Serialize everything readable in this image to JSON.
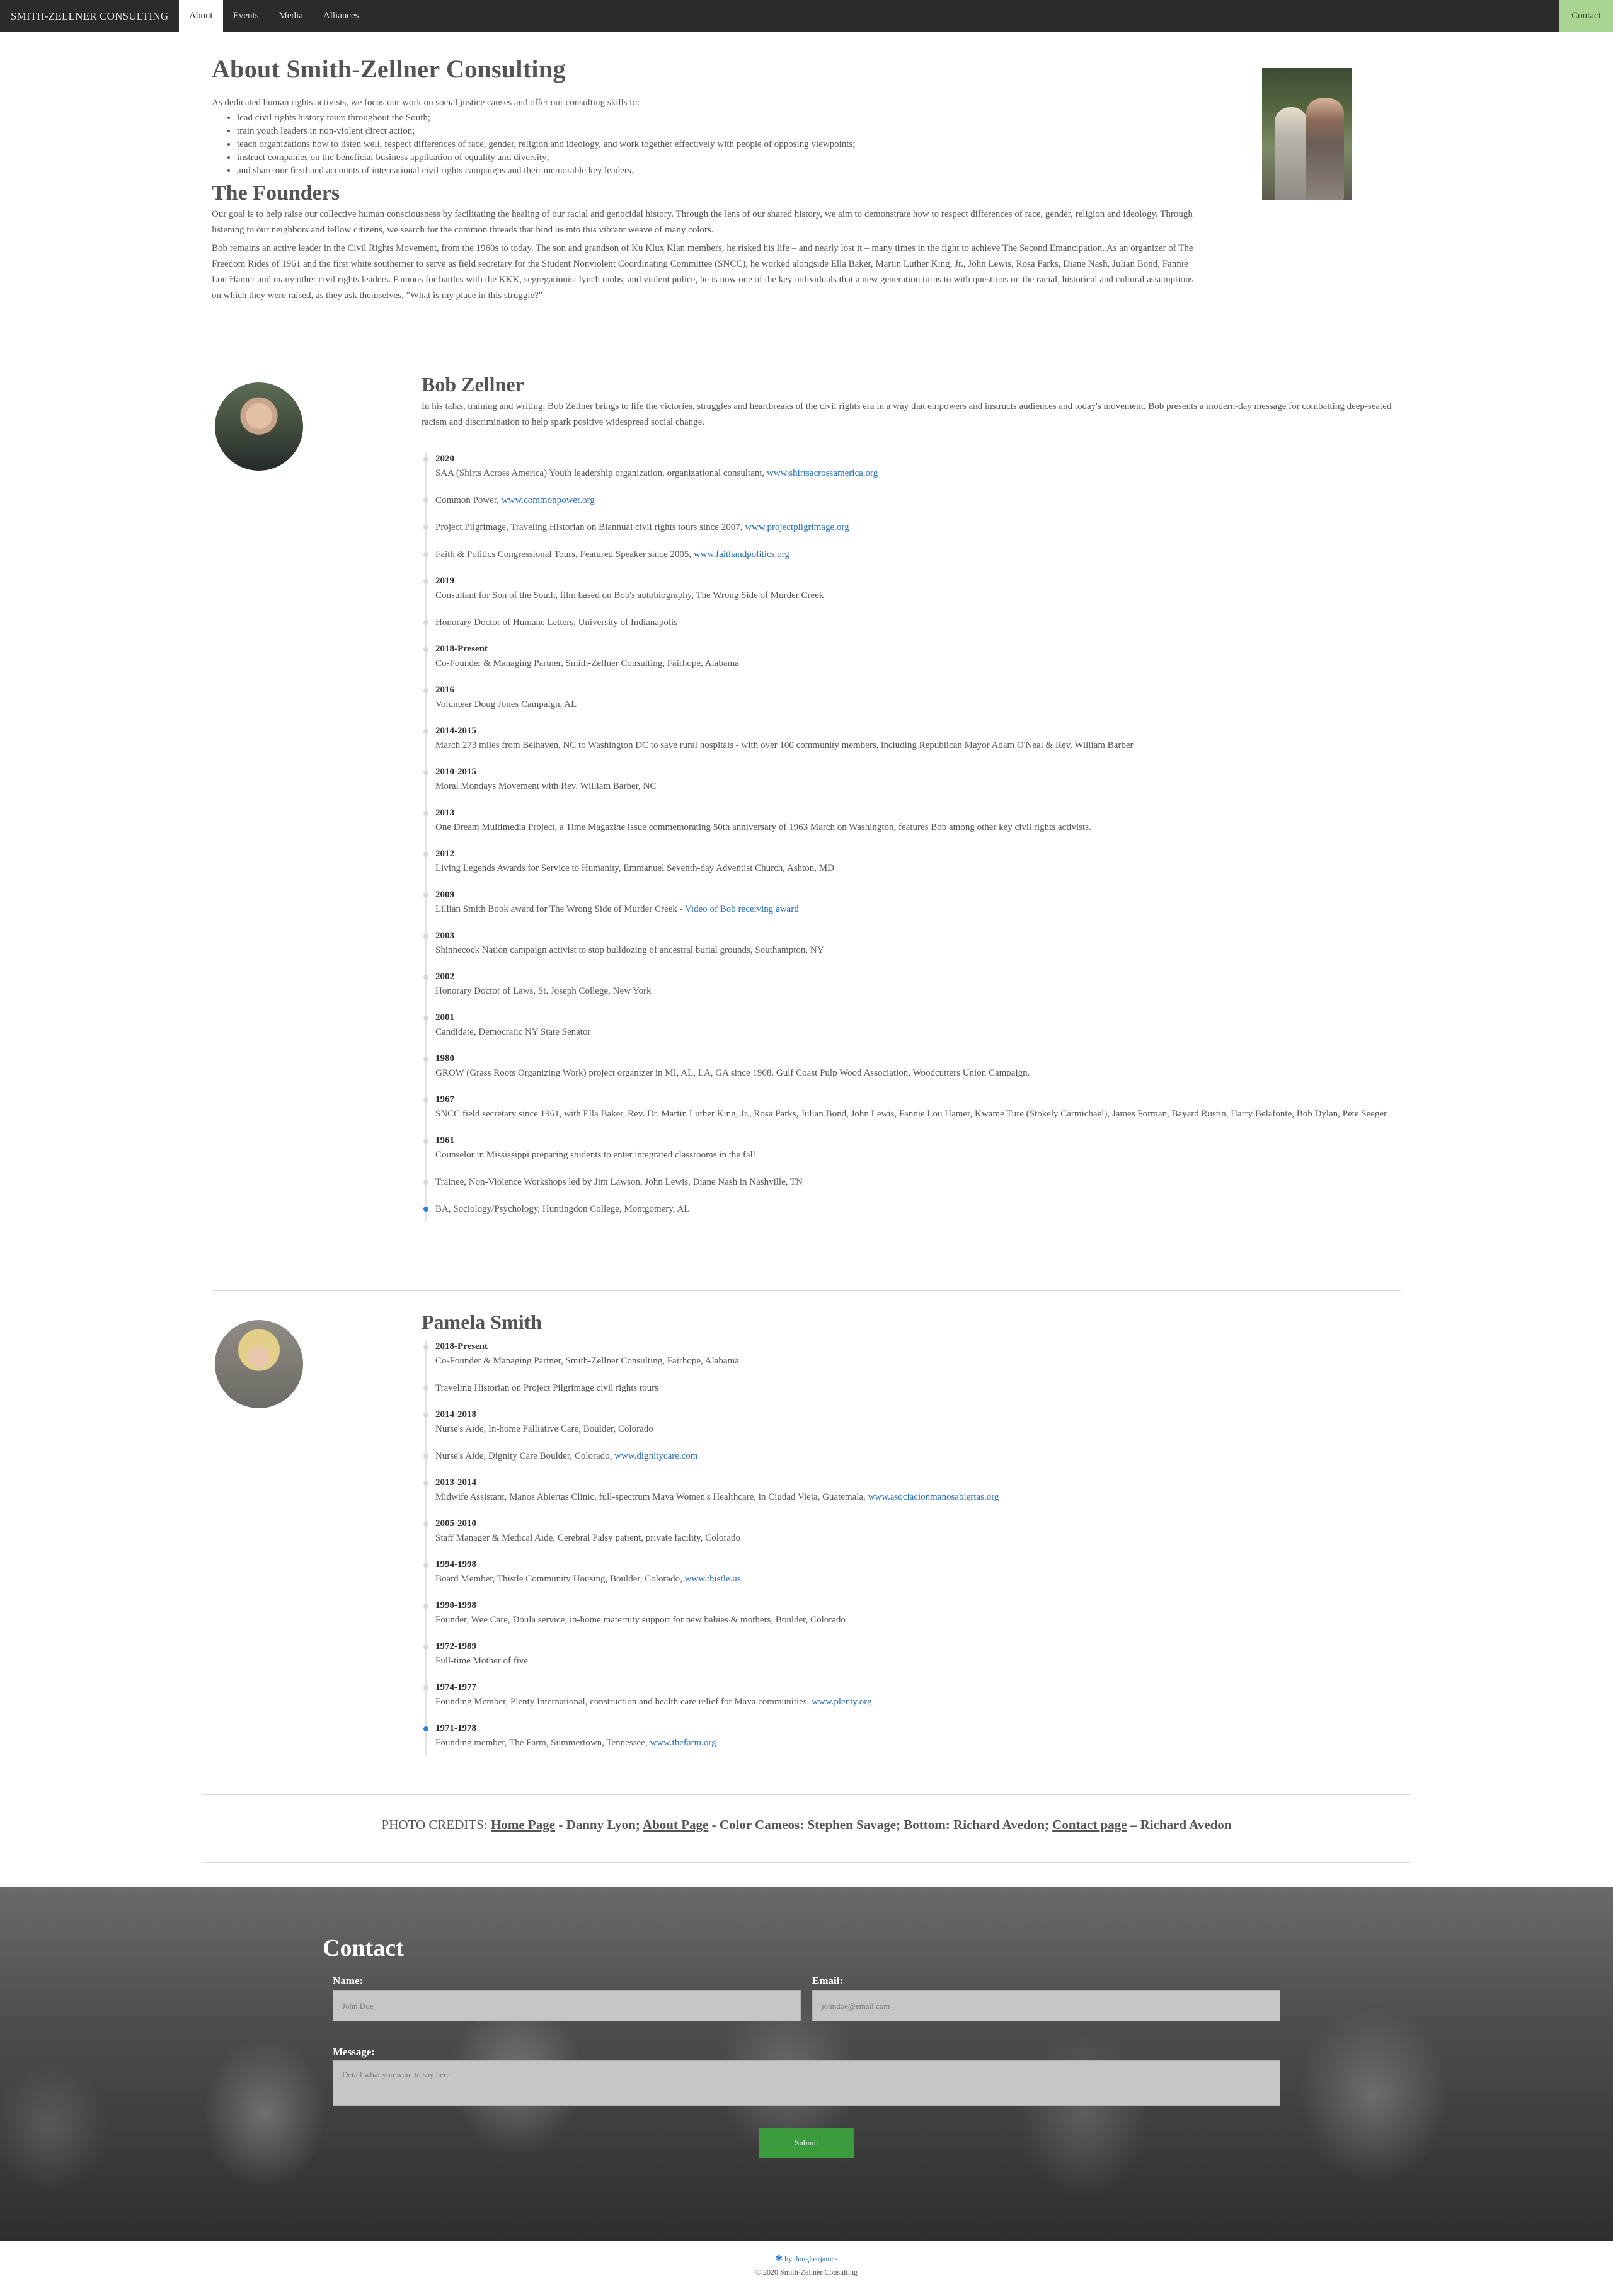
{
  "nav": {
    "brand": "SMITH-ZELLNER CONSULTING",
    "items": [
      "About",
      "Events",
      "Media",
      "Alliances"
    ],
    "active": "About",
    "contact": "Contact"
  },
  "intro": {
    "title": "About Smith-Zellner Consulting",
    "lead": "As dedicated human rights activists, we focus our work on social justice causes and offer our consulting skills to:",
    "bullets": [
      "lead civil rights history tours throughout the South;",
      "train youth leaders in non-violent direct action;",
      "teach organizations how to listen well, respect differences of race, gender, religion and ideology, and work together effectively with people of opposing viewpoints;",
      "instruct companies on the beneficial business application of equality and diversity;",
      "and share our firsthand accounts of international civil rights campaigns and their memorable key leaders."
    ],
    "founders_title": "The Founders",
    "founders_p1": "Our goal is to help raise our collective human consciousness by facilitating the healing of our racial and genocidal history. Through the lens of our shared history, we aim to demonstrate how to respect differences of race, gender, religion and ideology. Through listening to our neighbors and fellow citizens, we search for the common threads that bind us into this vibrant weave of many colors.",
    "founders_p2": "Bob remains an active leader in the Civil Rights Movement, from the 1960s to today. The son and grandson of Ku Klux Klan members, he risked his life – and nearly lost it – many times in the fight to achieve The Second Emancipation. As an organizer of The Freedom Rides of 1961 and the first white southerner to serve as field secretary for the Student Nonviolent Coordinating Committee (SNCC), he worked alongside Ella Baker, Martin Luther King, Jr., John Lewis, Rosa Parks, Diane Nash, Julian Bond, Fannie Lou Hamer and many other civil rights leaders. Famous for battles with the KKK, segregationist lynch mobs, and violent police, he is now one of the key individuals that a new generation turns to with questions on the racial, historical and cultural assumptions on which they were raised, as they ask themselves, \"What is my place in this struggle?\""
  },
  "bob": {
    "name": "Bob Zellner",
    "bio": "In his talks, training and writing, Bob Zellner brings to life the victories, struggles and heartbreaks of the civil rights era in a way that empowers and instructs audiences and today's movement. Bob presents a modern-day message for combatting deep-seated racism and discrimination to help spark positive widespread social change.",
    "timeline": [
      {
        "year": "2020",
        "text": "SAA (Shirts Across America) Youth leadership organization, organizational consultant, ",
        "link": "www.shirtsacrossamerica.org"
      },
      {
        "year": "",
        "text": "Common Power, ",
        "link": "www.commonpower.org"
      },
      {
        "year": "",
        "text": "Project Pilgrimage, Traveling Historian on Biannual civil rights tours since 2007, ",
        "link": "www.projectpilgrimage.org"
      },
      {
        "year": "",
        "text": "Faith & Politics Congressional Tours, Featured Speaker since 2005, ",
        "link": "www.faithandpolitics.org"
      },
      {
        "year": "2019",
        "text": "Consultant for Son of the South, film based on Bob's autobiography, The Wrong Side of Murder Creek",
        "link": ""
      },
      {
        "year": "",
        "text": "Honorary Doctor of Humane Letters, University of Indianapolis",
        "link": ""
      },
      {
        "year": "2018-Present",
        "text": "Co-Founder & Managing Partner, Smith-Zellner Consulting, Fairhope, Alabama",
        "link": ""
      },
      {
        "year": "2016",
        "text": "Volunteer Doug Jones Campaign, AL",
        "link": ""
      },
      {
        "year": "2014-2015",
        "text": "March 273 miles from Belhaven, NC to Washington DC to save rural hospitals - with over 100 community members, including Republican Mayor Adam O'Neal & Rev. William Barber",
        "link": ""
      },
      {
        "year": "2010-2015",
        "text": "Moral Mondays Movement with Rev. William Barber, NC",
        "link": ""
      },
      {
        "year": "2013",
        "text": "One Dream Multimedia Project, a Time Magazine issue commemorating 50th anniversary of 1963 March on Washington, features Bob among other key civil rights activists.",
        "link": ""
      },
      {
        "year": "2012",
        "text": "Living Legends Awards for Service to Humanity, Emmanuel Seventh-day Adventist Church, Ashton, MD",
        "link": ""
      },
      {
        "year": "2009",
        "text": "Lillian Smith Book award for The Wrong Side of Murder Creek - ",
        "link": "Video of Bob receiving award"
      },
      {
        "year": "2003",
        "text": "Shinnecock Nation campaign activist to stop bulldozing of ancestral burial grounds, Southampton, NY",
        "link": ""
      },
      {
        "year": "2002",
        "text": "Honorary Doctor of Laws, St. Joseph College, New York",
        "link": ""
      },
      {
        "year": "2001",
        "text": "Candidate, Democratic NY State Senator",
        "link": ""
      },
      {
        "year": "1980",
        "text": "GROW (Grass Roots Organizing Work) project organizer in MI, AL, LA, GA since 1968. Gulf Coast Pulp Wood Association, Woodcutters Union Campaign.",
        "link": ""
      },
      {
        "year": "1967",
        "text": "SNCC field secretary since 1961, with Ella Baker, Rev. Dr. Martin Luther King, Jr., Rosa Parks, Julian Bond, John Lewis, Fannie Lou Hamer, Kwame Ture (Stokely Carmichael), James Forman, Bayard Rustin, Harry Belafonte, Bob Dylan, Pete Seeger",
        "link": ""
      },
      {
        "year": "1961",
        "text": "Counselor in Mississippi preparing students to enter integrated classrooms in the fall",
        "link": ""
      },
      {
        "year": "",
        "text": "Trainee, Non-Violence Workshops led by Jim Lawson, John Lewis, Diane Nash in Nashville, TN",
        "link": ""
      },
      {
        "year": "",
        "text": "BA, Sociology/Psychology, Huntingdon College, Montgomery, AL",
        "link": ""
      }
    ]
  },
  "pamela": {
    "name": "Pamela Smith",
    "timeline": [
      {
        "year": "2018-Present",
        "text": "Co-Founder & Managing Partner, Smith-Zellner Consulting, Fairhope, Alabama",
        "link": ""
      },
      {
        "year": "",
        "text": "Traveling Historian on Project Pilgrimage civil rights tours",
        "link": ""
      },
      {
        "year": "2014-2018",
        "text": "Nurse's Aide, In-home Palliative Care, Boulder, Colorado",
        "link": ""
      },
      {
        "year": "",
        "text": "Nurse's Aide, Dignity Care Boulder, Colorado, ",
        "link": "www.dignitycare.com"
      },
      {
        "year": "2013-2014",
        "text": "Midwife Assistant, Manos Abiertas Clinic, full-spectrum Maya Women's Healthcare, in Ciudad Vieja, Guatemala, ",
        "link": "www.asociacionmanosabiertas.org"
      },
      {
        "year": "2005-2010",
        "text": "Staff Manager & Medical Aide, Cerebral Palsy patient, private facility, Colorado",
        "link": ""
      },
      {
        "year": "1994-1998",
        "text": "Board Member, Thistle Community Housing, Boulder, Colorado, ",
        "link": "www.thistle.us"
      },
      {
        "year": "1990-1998",
        "text": "Founder, Wee Care, Doula service, in-home maternity support for new babies & mothers, Boulder, Colorado",
        "link": ""
      },
      {
        "year": "1972-1989",
        "text": "Full-time Mother of five",
        "link": ""
      },
      {
        "year": "1974-1977",
        "text": "Founding Member, Plenty International, construction and health care relief for Maya communities. ",
        "link": "www.plenty.org"
      },
      {
        "year": "1971-1978",
        "text": "Founding member, The Farm, Summertown, Tennessee, ",
        "link": "www.thefarm.org"
      }
    ]
  },
  "credits": {
    "label": "PHOTO CREDITS:",
    "home_link": "Home Page",
    "home_credit": " - Danny Lyon; ",
    "about_link": "About Page",
    "about_credit": " - Color Cameos: Stephen Savage; Bottom: Richard Avedon; ",
    "contact_link": "Contact page",
    "contact_credit": " – Richard Avedon"
  },
  "contact": {
    "title": "Contact",
    "name_label": "Name:",
    "name_placeholder": "John Doe",
    "email_label": "Email:",
    "email_placeholder": "johndoe@email.com",
    "message_label": "Message:",
    "message_placeholder": "Detail what you want to say here.",
    "submit": "Submit"
  },
  "footer": {
    "byline": "by douglasrjames",
    "copyright": "© 2020 Smith-Zellner Consulting"
  }
}
